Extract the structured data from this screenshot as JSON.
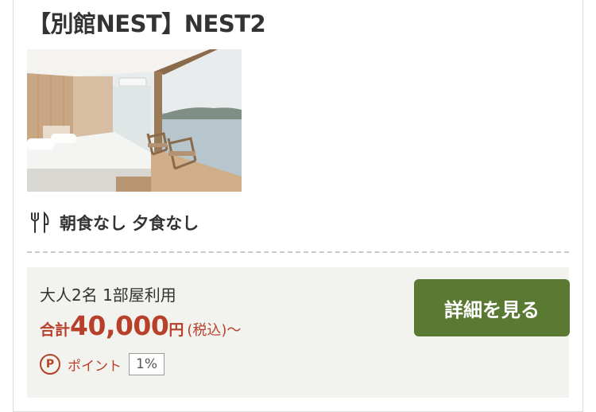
{
  "room": {
    "title": "【別館NEST】NEST2",
    "photo_icon": "room-photo"
  },
  "meal": {
    "icon": "fork-knife-icon",
    "text": "朝食なし 夕食なし"
  },
  "plan": {
    "guests": "大人2名 1部屋利用",
    "price_prefix": "合計",
    "price_amount": "40,000",
    "price_unit": "円",
    "price_tax": "(税込)〜",
    "points_icon": "P",
    "points_label": "ポイント",
    "points_rate": "1%",
    "detail_button": "詳細を見る"
  },
  "colors": {
    "accent_red": "#b8402a",
    "button_green": "#5a7a34",
    "plan_background": "#f2f3ee"
  }
}
